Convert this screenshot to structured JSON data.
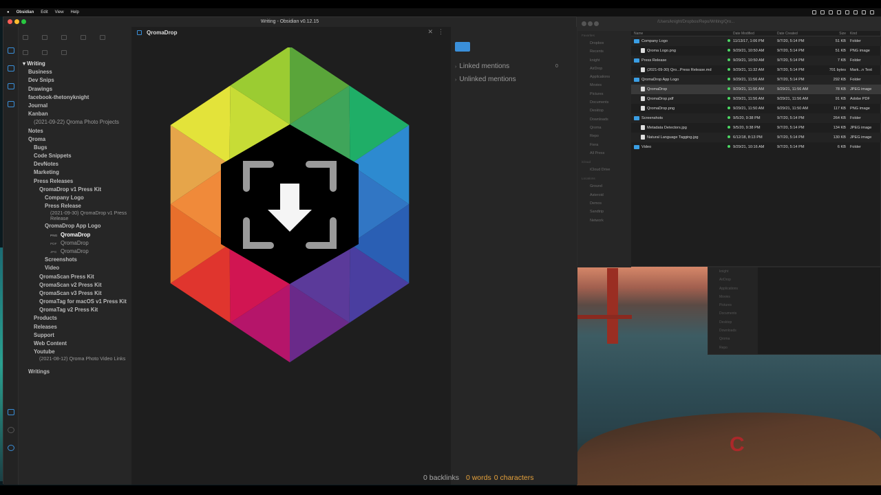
{
  "menubar": {
    "app": "Obsidian",
    "items": [
      "Edit",
      "View",
      "Help"
    ]
  },
  "obsidian": {
    "window_title": "Writing - Obsidian v0.12.15",
    "doc_title": "QromaDrop",
    "vault_name": "Writing",
    "tree": [
      {
        "label": "Business",
        "type": "folder",
        "indent": 1
      },
      {
        "label": "Dev Snips",
        "type": "folder",
        "indent": 1
      },
      {
        "label": "Drawings",
        "type": "folder",
        "indent": 1
      },
      {
        "label": "facebook-thetonyknight",
        "type": "folder",
        "indent": 1
      },
      {
        "label": "Journal",
        "type": "folder",
        "indent": 1
      },
      {
        "label": "Kanban",
        "type": "folder",
        "indent": 1
      },
      {
        "label": "(2021-09-22) Qroma Photo Projects",
        "type": "file",
        "indent": 2
      },
      {
        "label": "Notes",
        "type": "folder",
        "indent": 1
      },
      {
        "label": "Qroma",
        "type": "folder",
        "indent": 1
      },
      {
        "label": "Bugs",
        "type": "folder",
        "indent": 2
      },
      {
        "label": "Code Snippets",
        "type": "folder",
        "indent": 2
      },
      {
        "label": "DevNotes",
        "type": "folder",
        "indent": 2
      },
      {
        "label": "Marketing",
        "type": "folder",
        "indent": 2
      },
      {
        "label": "Press Releases",
        "type": "folder",
        "indent": 2
      },
      {
        "label": "QromaDrop v1 Press Kit",
        "type": "folder",
        "indent": 3
      },
      {
        "label": "Company Logo",
        "type": "folder",
        "indent": 4
      },
      {
        "label": "Press Release",
        "type": "folder",
        "indent": 4
      },
      {
        "label": "(2021-09-30) QromaDrop v1 Press Release",
        "type": "file2",
        "indent": 5
      },
      {
        "label": "QromaDrop App Logo",
        "type": "folder",
        "indent": 4
      },
      {
        "label": "QromaDrop",
        "type": "active",
        "indent": 5,
        "ext": "PNG"
      },
      {
        "label": "QromaDrop",
        "type": "file",
        "indent": 5,
        "ext": "PDF"
      },
      {
        "label": "QromaDrop",
        "type": "file",
        "indent": 5,
        "ext": "JPG"
      },
      {
        "label": "Screenshots",
        "type": "folder",
        "indent": 4
      },
      {
        "label": "Video",
        "type": "folder",
        "indent": 4
      },
      {
        "label": "QromaScan Press Kit",
        "type": "folder",
        "indent": 3
      },
      {
        "label": "QromaScan v2 Press Kit",
        "type": "folder",
        "indent": 3
      },
      {
        "label": "QromaScan v3 Press Kit",
        "type": "folder",
        "indent": 3
      },
      {
        "label": "QromaTag for macOS v1 Press Kit",
        "type": "folder",
        "indent": 3
      },
      {
        "label": "QromaTag v2 Press Kit",
        "type": "folder",
        "indent": 3
      },
      {
        "label": "Products",
        "type": "folder",
        "indent": 2
      },
      {
        "label": "Releases",
        "type": "folder",
        "indent": 2
      },
      {
        "label": "Support",
        "type": "folder",
        "indent": 2
      },
      {
        "label": "Web Content",
        "type": "folder",
        "indent": 2
      },
      {
        "label": "Youtube",
        "type": "folder",
        "indent": 2
      },
      {
        "label": "(2021-08-12) Qroma Photo Video Links",
        "type": "file2",
        "indent": 3
      },
      {
        "label": "Writings",
        "type": "folder",
        "indent": 1
      }
    ],
    "linked_mentions": "Linked mentions",
    "linked_count": "0",
    "unlinked_mentions": "Unlinked mentions",
    "status": {
      "backlinks": "0 backlinks",
      "words": "0 words",
      "characters": "0 characters"
    }
  },
  "finder": {
    "path": "/Users/knight/Dropbox/Repo/Writing/Qro...",
    "columns": [
      "Name",
      "Date Modified",
      "Date Created",
      "Size",
      "Kind"
    ],
    "sidebar_favorites_label": "Favorites",
    "sidebar": [
      "Dropbox",
      "Recents",
      "knight",
      "AirDrop",
      "Applications",
      "Movies",
      "Pictures",
      "Documents",
      "Desktop",
      "Downloads",
      "Qroma",
      "Repo",
      "Fiera",
      "All Press"
    ],
    "sidebar_icloud_label": "iCloud",
    "sidebar_icloud": [
      "iCloud Drive"
    ],
    "sidebar_locations_label": "Locations",
    "sidebar_locations": [
      "Ground",
      "Asteroid",
      "Demos",
      "Sandtrip",
      "Network"
    ],
    "rows": [
      {
        "name": "Company Logo",
        "kind": "Folder",
        "modified": "11/13/17, 1:06 PM",
        "created": "9/7/20, 5:14 PM",
        "size": "51 KB",
        "folder": true,
        "indent": 0
      },
      {
        "name": "Qroma Logo.png",
        "kind": "PNG image",
        "modified": "9/29/21, 10:50 AM",
        "created": "9/7/20, 5:14 PM",
        "size": "51 KB",
        "folder": false,
        "indent": 1
      },
      {
        "name": "Press Release",
        "kind": "Folder",
        "modified": "9/29/21, 10:50 AM",
        "created": "9/7/20, 5:14 PM",
        "size": "7 KB",
        "folder": true,
        "indent": 0
      },
      {
        "name": "(2021-09-30) Qro...Press Release.md",
        "kind": "Mark...n Text",
        "modified": "9/29/21, 11:32 AM",
        "created": "9/7/20, 5:14 PM",
        "size": "701 bytes",
        "folder": false,
        "indent": 1
      },
      {
        "name": "QromaDrop App Logo",
        "kind": "Folder",
        "modified": "9/29/21, 11:56 AM",
        "created": "9/7/20, 5:14 PM",
        "size": "292 KB",
        "folder": true,
        "indent": 0
      },
      {
        "name": "QromaDrop",
        "kind": "JPEG image",
        "modified": "9/29/21, 11:56 AM",
        "created": "9/29/21, 11:56 AM",
        "size": "78 KB",
        "folder": false,
        "indent": 1,
        "selected": true
      },
      {
        "name": "QromaDrop.pdf",
        "kind": "Adobe PDF",
        "modified": "9/29/21, 11:56 AM",
        "created": "9/29/21, 11:56 AM",
        "size": "91 KB",
        "folder": false,
        "indent": 1
      },
      {
        "name": "QromaDrop.png",
        "kind": "PNG image",
        "modified": "9/29/21, 11:50 AM",
        "created": "9/29/21, 11:50 AM",
        "size": "117 KB",
        "folder": false,
        "indent": 1
      },
      {
        "name": "Screenshots",
        "kind": "Folder",
        "modified": "9/5/20, 9:38 PM",
        "created": "9/7/20, 5:14 PM",
        "size": "264 KB",
        "folder": true,
        "indent": 0
      },
      {
        "name": "Metadata Detectors.jpg",
        "kind": "JPEG image",
        "modified": "9/5/20, 9:38 PM",
        "created": "9/7/20, 5:14 PM",
        "size": "134 KB",
        "folder": false,
        "indent": 1
      },
      {
        "name": "Natural Language Tagging.jpg",
        "kind": "JPEG image",
        "modified": "6/12/18, 8:13 PM",
        "created": "9/7/20, 5:14 PM",
        "size": "130 KB",
        "folder": false,
        "indent": 1
      },
      {
        "name": "Video",
        "kind": "Folder",
        "modified": "9/29/21, 10:16 AM",
        "created": "9/7/20, 5:14 PM",
        "size": "6 KB",
        "folder": true,
        "indent": 0
      }
    ]
  },
  "finder2": {
    "sidebar": [
      "knight",
      "AirDrop",
      "Applications",
      "Movies",
      "Pictures",
      "Documents",
      "Desktop",
      "Downloads",
      "Qroma",
      "Repo"
    ]
  },
  "colors": {
    "accent": "#3a8fd9",
    "orange": "#e6a23c"
  }
}
